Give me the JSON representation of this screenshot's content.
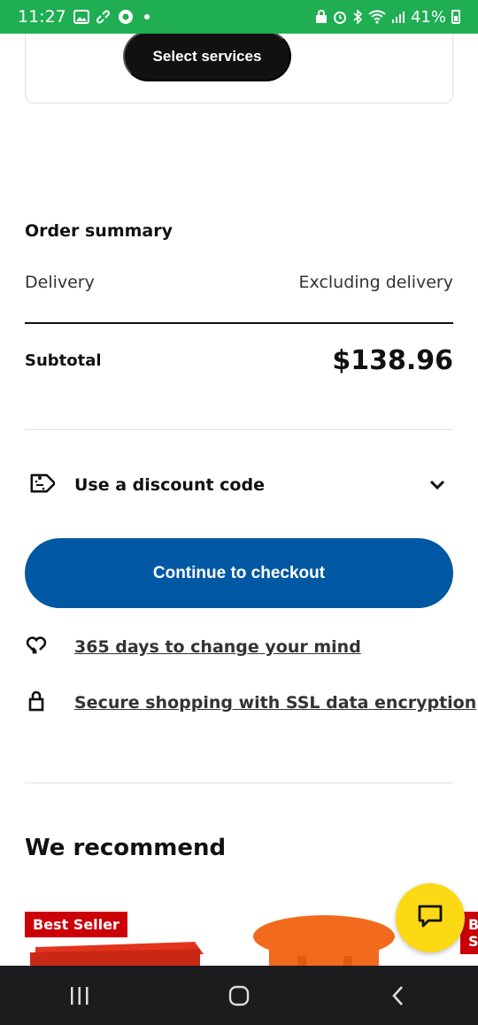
{
  "status_bar": {
    "time": "11:27",
    "battery": "41%"
  },
  "services": {
    "select_label": "Select services"
  },
  "order_summary": {
    "title": "Order summary",
    "delivery_label": "Delivery",
    "delivery_value": "Excluding delivery",
    "subtotal_label": "Subtotal",
    "subtotal_value": "$138.96"
  },
  "discount": {
    "label": "Use a discount code"
  },
  "checkout": {
    "label": "Continue to checkout"
  },
  "assurances": {
    "change_mind": "365 days to change your mind",
    "secure": "Secure shopping with SSL data encryption"
  },
  "recommend": {
    "title": "We recommend",
    "products": [
      {
        "badge": "Best Seller",
        "color": "#e2341d"
      },
      {
        "badge": "Best Seller",
        "color": "#f26a1b"
      }
    ]
  },
  "colors": {
    "status_green": "#1fae52",
    "ikea_blue": "#0058a3",
    "chat_yellow": "#fbd914",
    "badge_red": "#cc0008"
  }
}
